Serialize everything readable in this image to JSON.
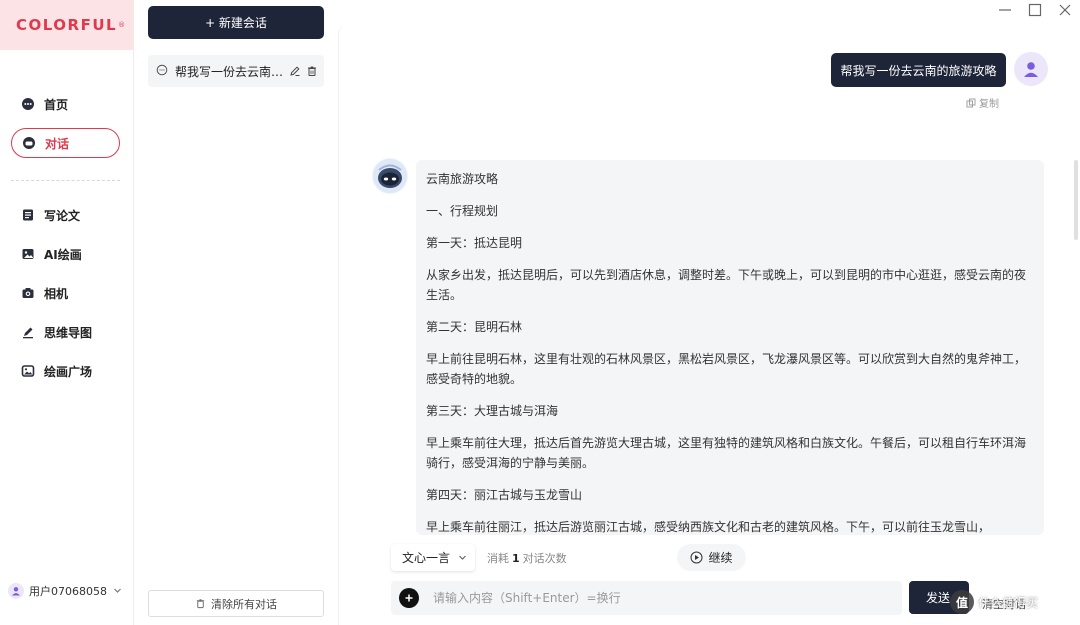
{
  "brand": {
    "logo_text": "COLORFUL",
    "logo_mark": "®",
    "color": "#e0394d"
  },
  "nav": {
    "items": [
      {
        "label": "首页",
        "icon": "home-icon",
        "active": false
      },
      {
        "label": "对话",
        "icon": "chat-icon",
        "active": true
      },
      {
        "label": "写论文",
        "icon": "document-icon",
        "active": false
      },
      {
        "label": "AI绘画",
        "icon": "image-icon",
        "active": false
      },
      {
        "label": "相机",
        "icon": "camera-icon",
        "active": false
      },
      {
        "label": "思维导图",
        "icon": "pen-icon",
        "active": false
      },
      {
        "label": "绘画广场",
        "icon": "gallery-icon",
        "active": false
      }
    ],
    "user": {
      "name": "用户07068058"
    }
  },
  "sidebar": {
    "new_chat_label": "+ 新建会话",
    "conversations": [
      {
        "title": "帮我写一份去云南的旅游攻略"
      }
    ],
    "clear_all_label": "清除所有对话"
  },
  "chat": {
    "user_message": "帮我写一份去云南的旅游攻略",
    "copy_label": "复制",
    "bot_paragraphs": [
      "云南旅游攻略",
      "一、行程规划",
      "第一天：抵达昆明",
      "从家乡出发，抵达昆明后，可以先到酒店休息，调整时差。下午或晚上，可以到昆明的市中心逛逛，感受云南的夜生活。",
      "第二天：昆明石林",
      "早上前往昆明石林，这里有壮观的石林风景区，黑松岩风景区，飞龙瀑风景区等。可以欣赏到大自然的鬼斧神工，感受奇特的地貌。",
      "第三天：大理古城与洱海",
      "早上乘车前往大理，抵达后首先游览大理古城，这里有独特的建筑风格和白族文化。午餐后，可以租自行车环洱海骑行，感受洱海的宁静与美丽。",
      "第四天：丽江古城与玉龙雪山",
      "早上乘车前往丽江，抵达后游览丽江古城，感受纳西族文化和古老的建筑风格。下午，可以前往玉龙雪山，"
    ]
  },
  "composer": {
    "model": "文心一言",
    "usage_prefix": "消耗",
    "usage_count": "1",
    "usage_suffix": "对话次数",
    "continue_label": "继续",
    "input_placeholder": "请输入内容（Shift+Enter）=换行",
    "send_label": "发送",
    "clear_label": "清空对话"
  },
  "watermark": {
    "mark": "值",
    "text": "什么值得买"
  }
}
